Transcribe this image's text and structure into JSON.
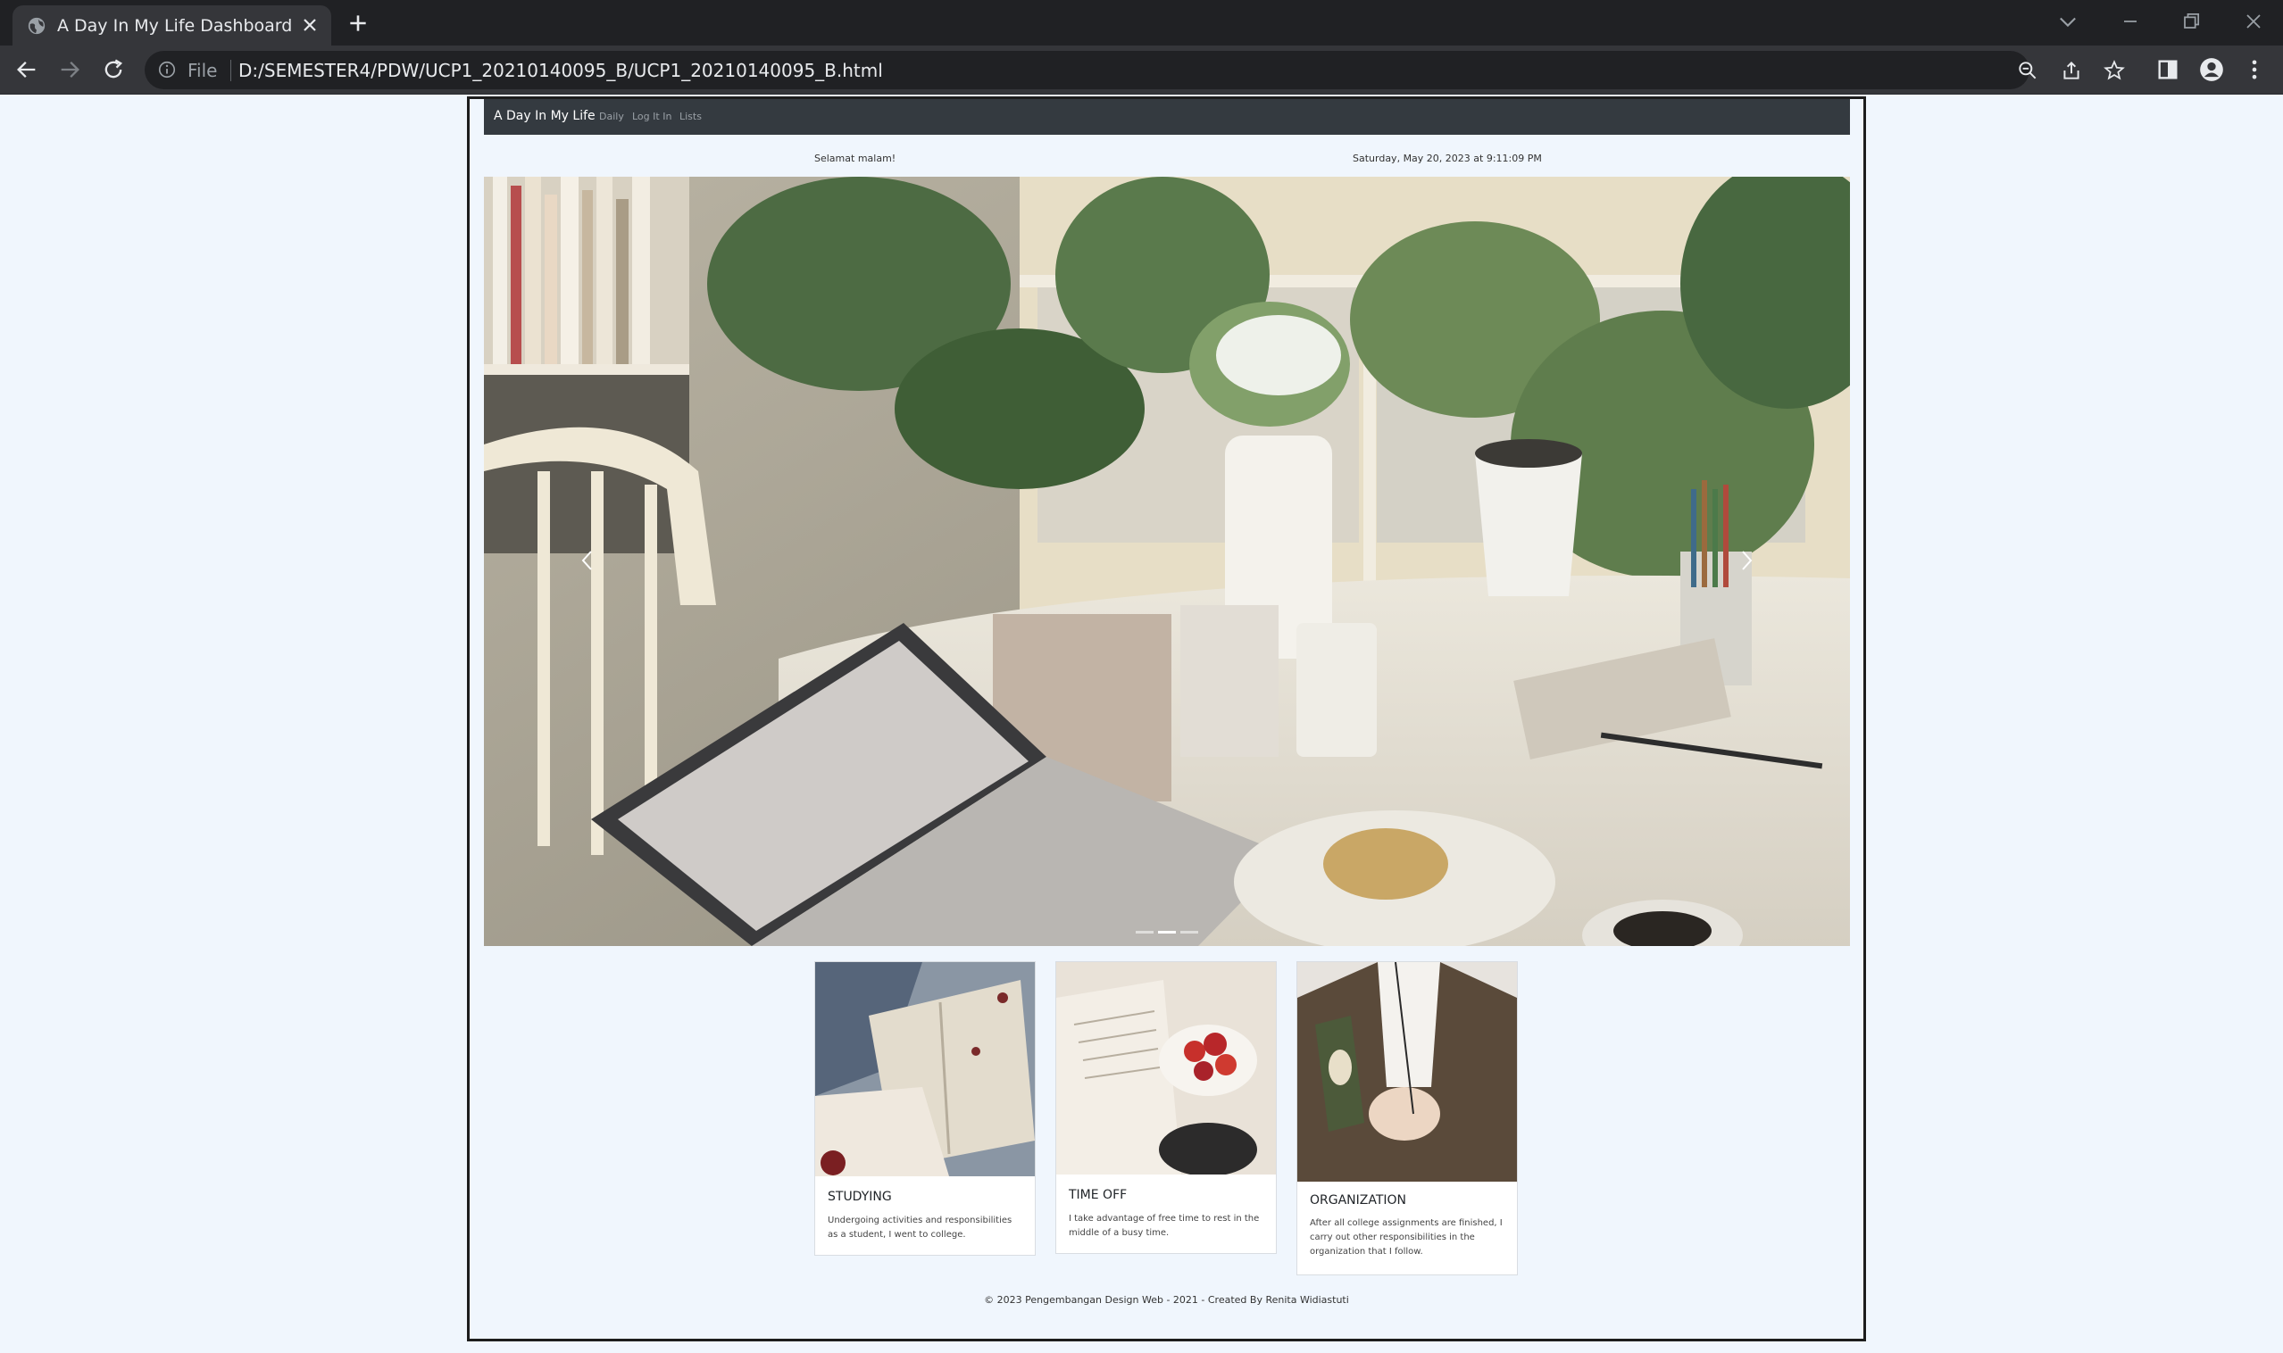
{
  "browser": {
    "tab_title": "A Day In My Life Dashboard",
    "file_label": "File",
    "url": "D:/SEMESTER4/PDW/UCP1_20210140095_B/UCP1_20210140095_B.html",
    "icons": [
      "globe-icon",
      "close-icon",
      "plus-icon",
      "chevron-down-icon",
      "minimize-icon",
      "restore-icon",
      "close-window-icon",
      "back-arrow-icon",
      "forward-arrow-icon",
      "reload-icon",
      "info-icon",
      "zoom-icon",
      "share-icon",
      "star-icon",
      "side-panel-icon",
      "profile-icon",
      "more-vert-icon"
    ]
  },
  "site": {
    "brand": "A Day In My Life",
    "nav": [
      "Daily",
      "Log It In",
      "Lists"
    ],
    "greeting": "Selamat malam!",
    "datetime": "Saturday, May 20, 2023 at 9:11:09 PM"
  },
  "cards": [
    {
      "title": "STUDYING",
      "text": "Undergoing activities and responsibilities as a student, I went to college."
    },
    {
      "title": "TIME OFF",
      "text": "I take advantage of free time to rest in the middle of a busy time."
    },
    {
      "title": "ORGANIZATION",
      "text": "After all college assignments are finished, I carry out other responsibilities in the organization that I follow."
    }
  ],
  "footer": "© 2023 Pengembangan Design Web - 2021 - Created By Renita Widiastuti",
  "colors": {
    "navbar": "#343a40",
    "page_bg": "#f0f6fd",
    "browser_dark": "#202124",
    "browser_toolbar": "#35363a"
  }
}
